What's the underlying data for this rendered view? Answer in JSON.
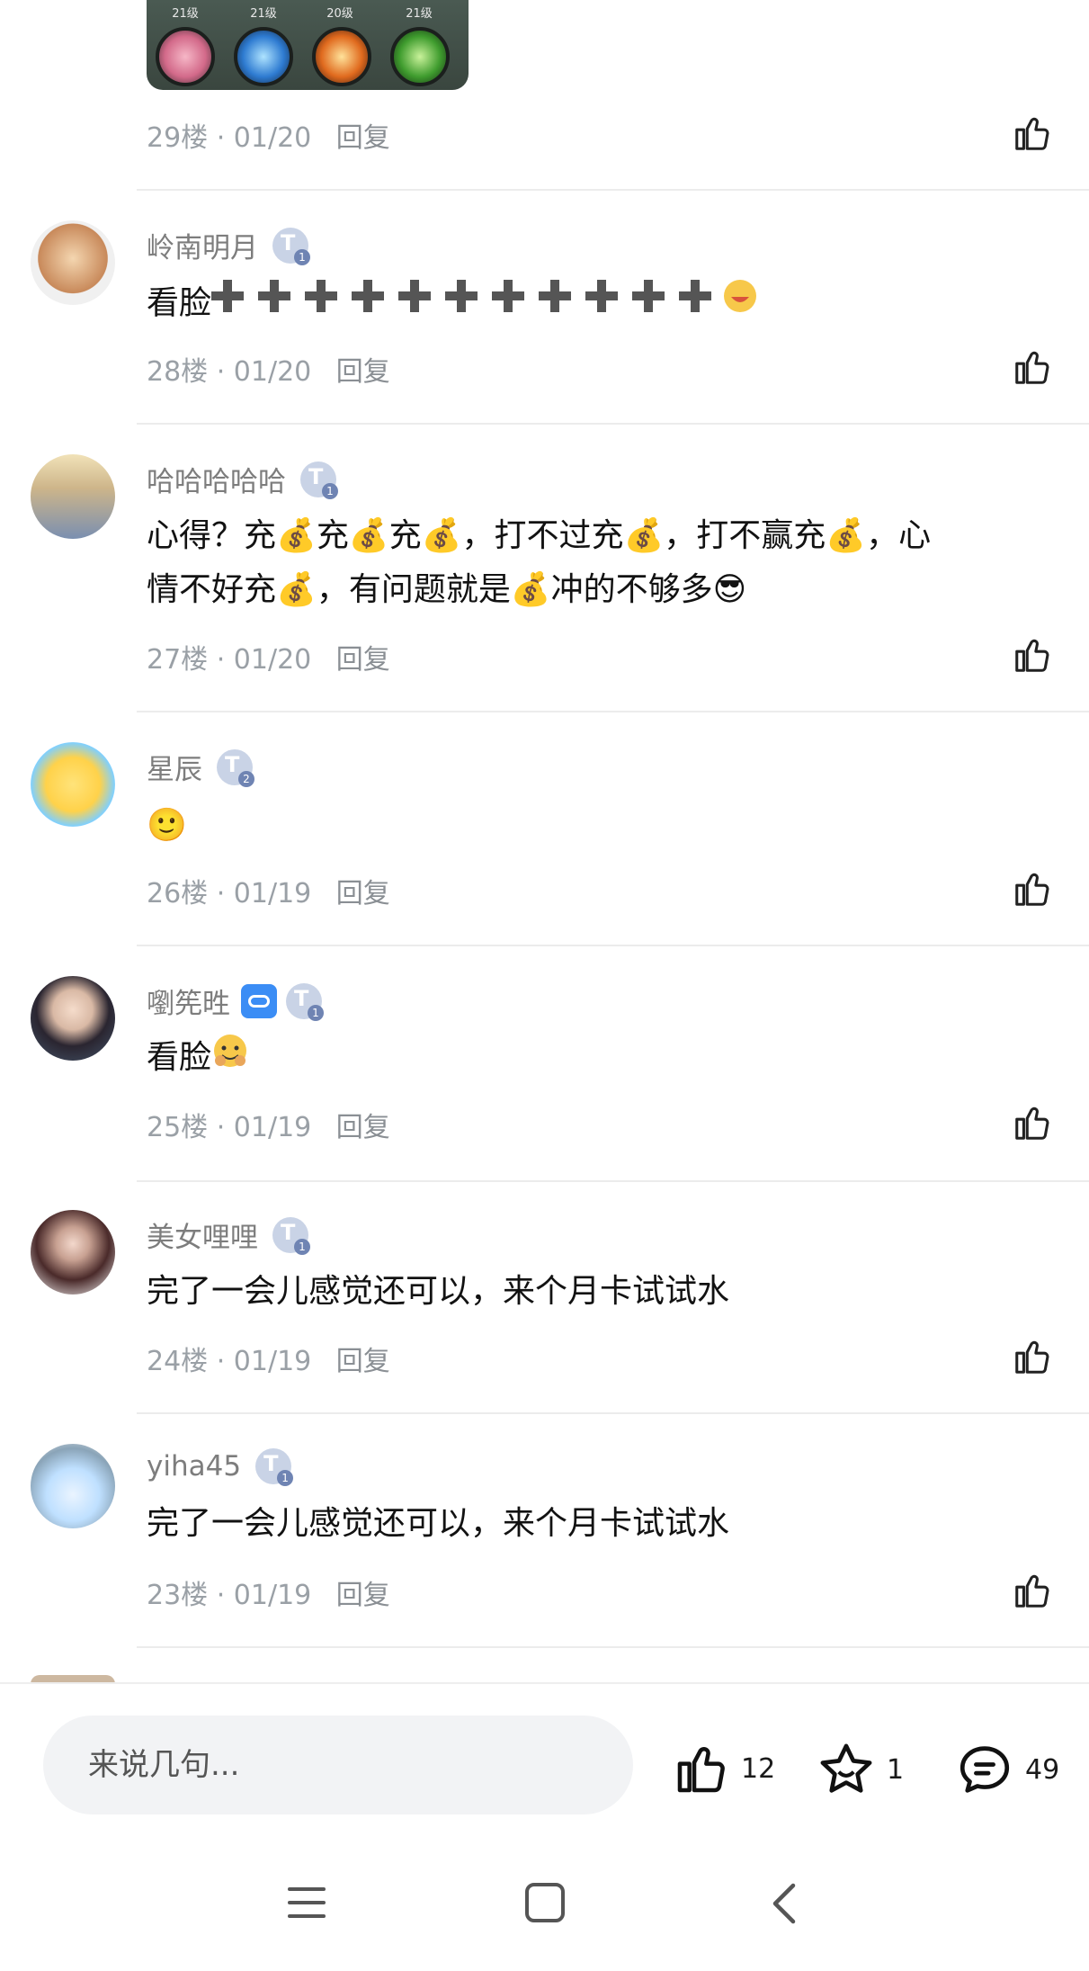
{
  "top_image": {
    "levels": [
      "21级",
      "21级",
      "20级",
      "21级"
    ]
  },
  "comments": [
    {
      "floor_meta": "29楼 · 01/20",
      "reply_label": "回复"
    },
    {
      "username": "岭南明月",
      "badge": "1",
      "content": "看脸",
      "floor_meta": "28楼 · 01/20",
      "reply_label": "回复"
    },
    {
      "username": "哈哈哈哈哈",
      "badge": "1",
      "content_line1": "心得？充💰充💰充💰，打不过充💰，打不赢充💰，心",
      "content_line2": "情不好充💰，有问题就是💰冲的不够多😎",
      "floor_meta": "27楼 · 01/20",
      "reply_label": "回复"
    },
    {
      "username": "星辰",
      "badge": "2",
      "content": "🙂",
      "floor_meta": "26楼 · 01/19",
      "reply_label": "回复"
    },
    {
      "username": "嚠筅甠",
      "badge": "1",
      "content": "看脸",
      "floor_meta": "25楼 · 01/19",
      "reply_label": "回复"
    },
    {
      "username": "美女哩哩",
      "badge": "1",
      "content": "完了一会儿感觉还可以，来个月卡试试水",
      "floor_meta": "24楼 · 01/19",
      "reply_label": "回复"
    },
    {
      "username": "yiha45",
      "badge": "1",
      "content": "完了一会儿感觉还可以，来个月卡试试水",
      "floor_meta": "23楼 · 01/19",
      "reply_label": "回复"
    }
  ],
  "bottom_bar": {
    "input_placeholder": "来说几句...",
    "like_count": "12",
    "favorite_count": "1",
    "comment_count": "49"
  },
  "icons": {
    "like": "thumbs-up-icon",
    "favorite": "star-icon",
    "comment": "comment-bubble-icon",
    "nav_menu": "menu-icon",
    "nav_home": "square-home-icon",
    "nav_back": "back-chevron-icon"
  }
}
